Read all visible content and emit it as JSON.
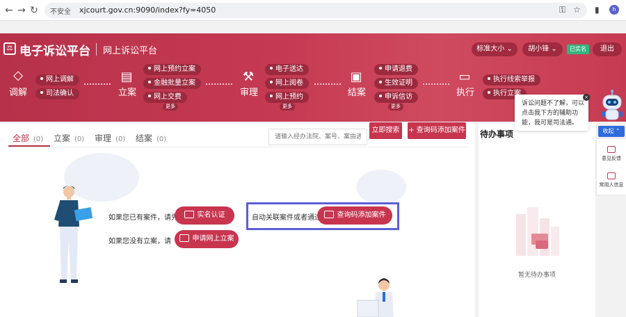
{
  "browser": {
    "insecure_label": "不安全",
    "url": "xjcourt.gov.cn:9090/index?fy=4050",
    "profile_initial": "h"
  },
  "header": {
    "brand": "电子诉讼平台",
    "subbrand": "网上诉讼平台",
    "font_size_label": "标准大小",
    "user_name": "胡小锋",
    "verified": "已实名",
    "logout": "退出"
  },
  "stages": [
    {
      "name": "调解",
      "icon": "handshake-icon",
      "items": [
        "网上调解",
        "司法确认"
      ],
      "more": ""
    },
    {
      "name": "立案",
      "icon": "file-icon",
      "items": [
        "网上预约立案",
        "金融批量立案",
        "网上交费"
      ],
      "more": "更多"
    },
    {
      "name": "审理",
      "icon": "gavel-icon",
      "items": [
        "电子送达",
        "网上阅卷",
        "网上预约"
      ],
      "more": "更多"
    },
    {
      "name": "结案",
      "icon": "document-check-icon",
      "items": [
        "申请退费",
        "生效证明",
        "申诉信访"
      ],
      "more": "更多"
    },
    {
      "name": "执行",
      "icon": "monitor-icon",
      "items": [
        "执行线索举报",
        "执行立案"
      ],
      "more": ""
    }
  ],
  "tabs": [
    {
      "label": "全部",
      "count": "(0)"
    },
    {
      "label": "立案",
      "count": "(0)"
    },
    {
      "label": "审理",
      "count": "(0)"
    },
    {
      "label": "结案",
      "count": "(0)"
    }
  ],
  "search": {
    "placeholder": "请输入经办法院、案号、案由进行",
    "button": "立即搜索",
    "add_button": "+ 查询码添加案件"
  },
  "empty_state": {
    "line1_prefix": "如果您已有案件，请先",
    "realname_button": "实名认证",
    "line2_prefix": "如果您没有立案，请",
    "apply_button": "申请网上立案",
    "auto_link_prefix": "自动关联案件或者通过",
    "query_button": "查询码添加案件"
  },
  "todo": {
    "title": "待办事项",
    "empty": "暂无待办事项"
  },
  "assistant": {
    "bubble": "诉讼问题不了解，可以点击我下方的辅助功能，我可是司法通。",
    "fold": "收起",
    "feedback": "意见反馈",
    "contacts": "常用人信息"
  }
}
